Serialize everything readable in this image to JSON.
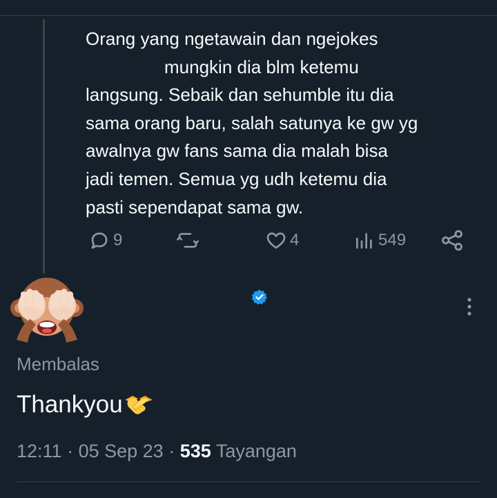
{
  "parent_tweet": {
    "lines": [
      "Orang yang ngetawain dan ngejokes",
      "mungkin dia blm ketemu",
      "langsung. Sebaik dan sehumble itu dia",
      "sama orang baru, salah satunya ke gw yg",
      "awalnya gw fans sama dia malah bisa",
      "jadi temen. Semua yg udh ketemu dia",
      "pasti sependapat sama gw."
    ],
    "actions": {
      "reply_count": "9",
      "retweet_count": "",
      "like_count": "4",
      "views_count": "549"
    }
  },
  "reply_tweet": {
    "avatar_icon": "see-no-evil-monkey-icon",
    "replying_label": "Membalas",
    "text": "Thankyou",
    "emoji_icon": "handshake-icon",
    "time": "12:11",
    "sep1": "·",
    "date": "05 Sep 23",
    "sep2": "·",
    "views": "535",
    "views_label": "Tayangan"
  },
  "colors": {
    "background": "#15202b",
    "text_primary": "#f7f9f9",
    "text_secondary": "#8b98a5",
    "divider": "#38444d",
    "verified_blue": "#1d9bf0"
  }
}
